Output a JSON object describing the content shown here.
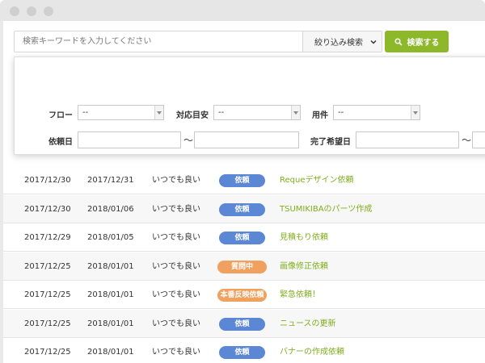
{
  "search": {
    "placeholder": "検索キーワードを入力してください",
    "refine_label": "絞り込み検索",
    "button_label": "検索する"
  },
  "filters": {
    "flow_label": "フロー",
    "flow_value": "--",
    "target_label": "対応目安",
    "target_value": "--",
    "matter_label": "用件",
    "matter_value": "--",
    "request_date_label": "依頼日",
    "due_date_label": "完了希望日",
    "range_separator": "〜"
  },
  "rows": [
    {
      "request_date": "2017/12/30",
      "due_date": "2017/12/31",
      "target": "いつでも良い",
      "status": "依頼",
      "status_color": "#5b87d4",
      "title": "Requeデザイン依頼"
    },
    {
      "request_date": "2017/12/30",
      "due_date": "2018/01/06",
      "target": "いつでも良い",
      "status": "依頼",
      "status_color": "#5b87d4",
      "title": "TSUMIKIBAのパーツ作成"
    },
    {
      "request_date": "2017/12/29",
      "due_date": "2018/01/05",
      "target": "いつでも良い",
      "status": "依頼",
      "status_color": "#5b87d4",
      "title": "見積もり依頼"
    },
    {
      "request_date": "2017/12/25",
      "due_date": "2018/01/01",
      "target": "いつでも良い",
      "status": "質問中",
      "status_color": "#f0a15e",
      "title": "画像修正依頼"
    },
    {
      "request_date": "2017/12/25",
      "due_date": "2018/01/01",
      "target": "いつでも良い",
      "status": "本番反映依頼",
      "status_color": "#f0a15e",
      "title": "緊急依頼！"
    },
    {
      "request_date": "2017/12/25",
      "due_date": "2018/01/01",
      "target": "いつでも良い",
      "status": "依頼",
      "status_color": "#5b87d4",
      "title": "ニュースの更新"
    },
    {
      "request_date": "2017/12/25",
      "due_date": "2018/01/01",
      "target": "いつでも良い",
      "status": "依頼",
      "status_color": "#5b87d4",
      "title": "バナーの作成依頼"
    }
  ]
}
